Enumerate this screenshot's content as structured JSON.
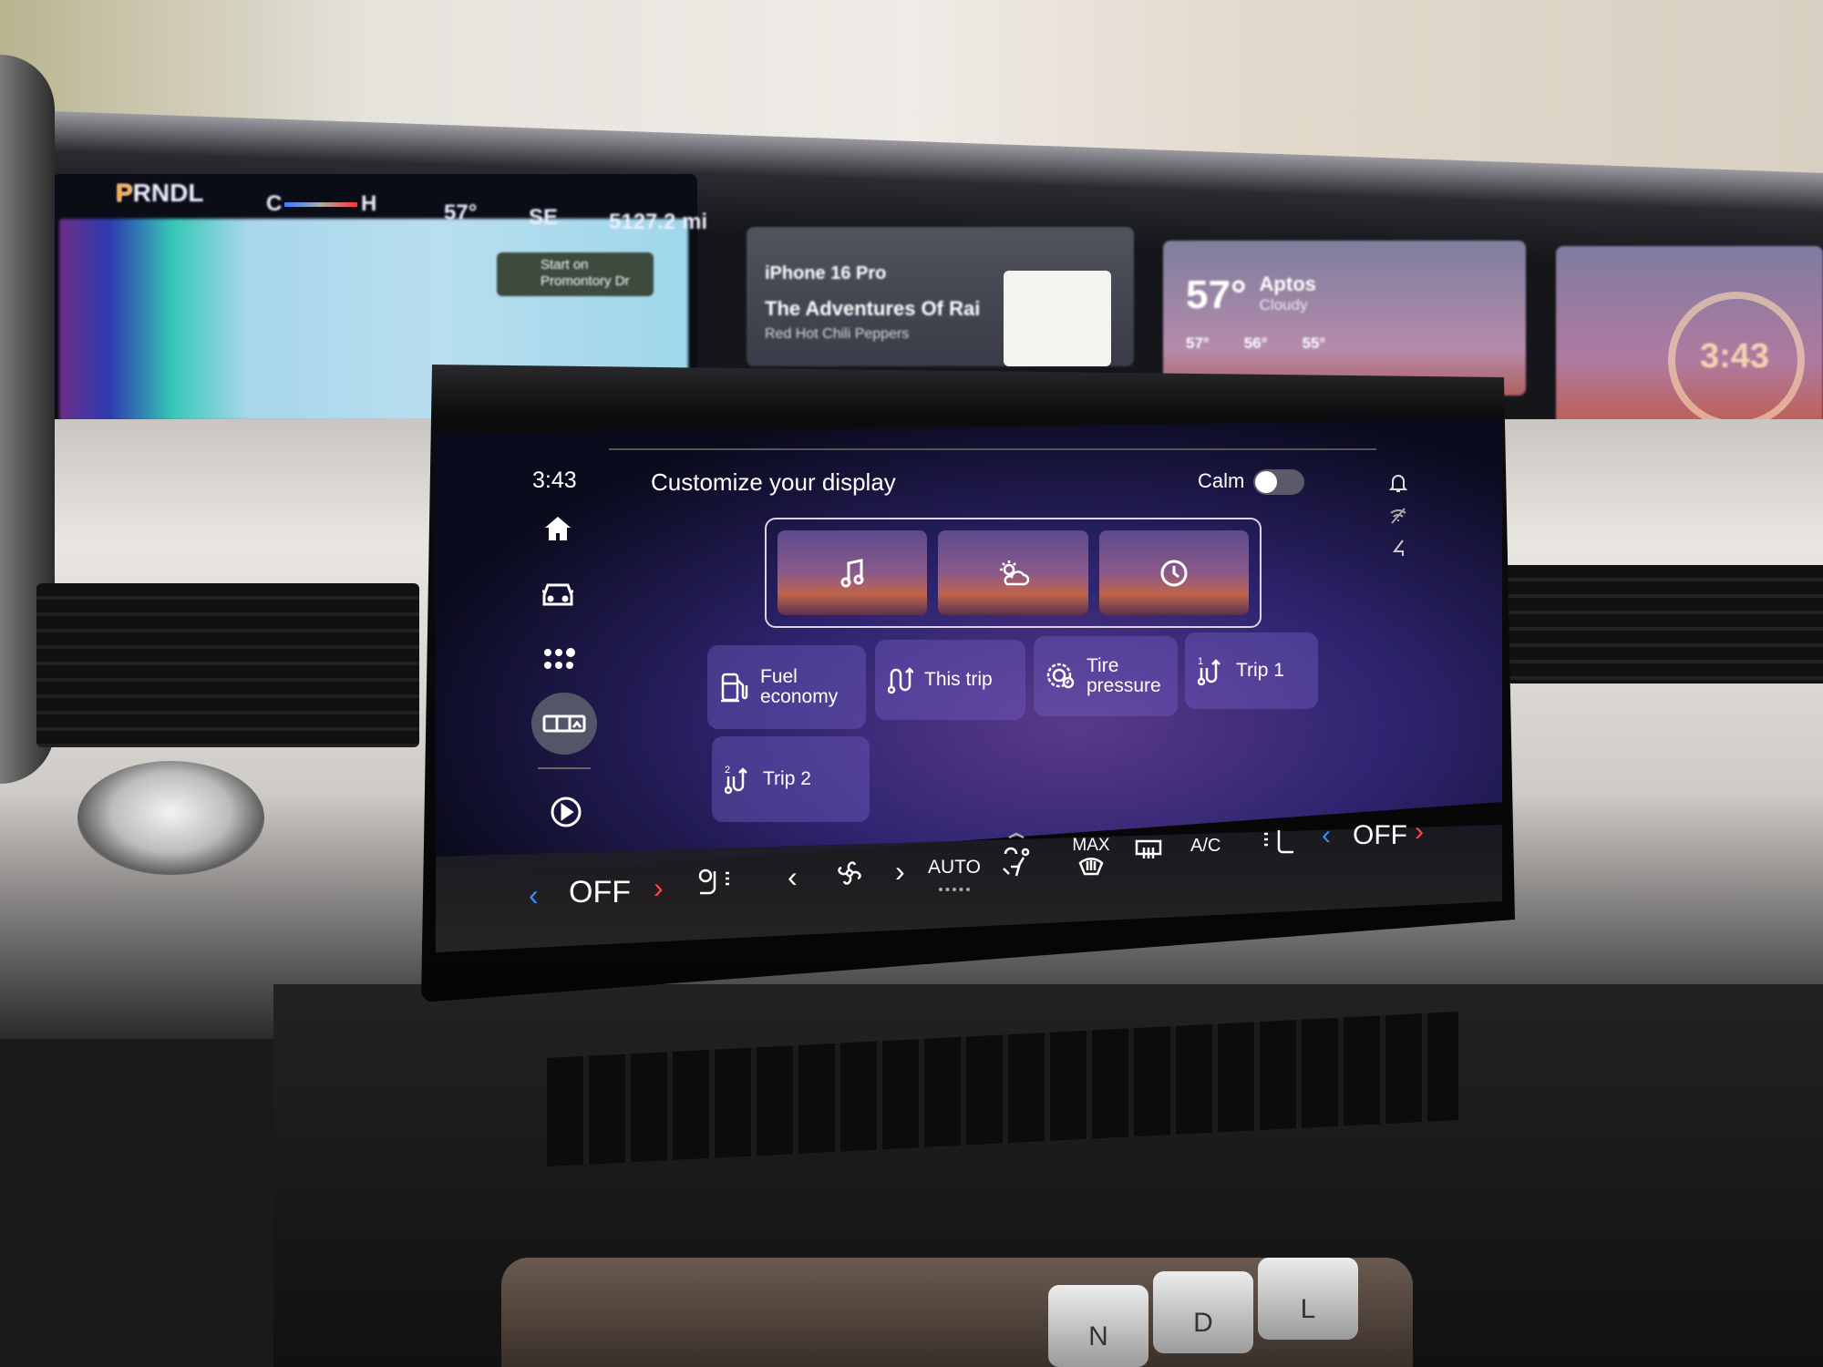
{
  "cluster": {
    "gear_indicator": "PRNDL",
    "active_gear": "P",
    "temp_gauge_low": "C",
    "temp_gauge_high": "H",
    "outside_temp": "57°",
    "heading": "SE",
    "odometer": "5127.2 mi",
    "nav_instruction": "Start on Promontory Dr",
    "media": {
      "device": "iPhone 16 Pro",
      "track": "The Adventures Of Rai",
      "artist": "Red Hot Chili Peppers"
    },
    "weather": {
      "temp": "57°",
      "city": "Aptos",
      "condition": "Cloudy",
      "forecast": [
        "57°",
        "56°",
        "55°"
      ]
    },
    "clock": "3:43"
  },
  "screen": {
    "time": "3:43",
    "title": "Customize your display",
    "calm_label": "Calm",
    "calm_on": false,
    "sidebar": [
      {
        "icon": "home-icon"
      },
      {
        "icon": "car-icon"
      },
      {
        "icon": "apps-icon"
      },
      {
        "icon": "display-layout-icon",
        "active": true
      },
      {
        "icon": "play-icon"
      }
    ],
    "status_icons": [
      "bell-icon",
      "wifi-off-icon",
      "navigation-arrow-icon"
    ],
    "widgets": [
      {
        "icon": "music-note-icon"
      },
      {
        "icon": "weather-icon"
      },
      {
        "icon": "clock-icon"
      }
    ],
    "tiles": [
      {
        "label": "Fuel economy",
        "icon": "fuel-pump-icon"
      },
      {
        "label": "This trip",
        "icon": "trip-icon"
      },
      {
        "label": "Tire pressure",
        "icon": "tire-pressure-icon"
      },
      {
        "label": "Trip 1",
        "icon": "trip-1-icon"
      },
      {
        "label": "Trip 2",
        "icon": "trip-2-icon"
      }
    ]
  },
  "climate": {
    "driver_temp": "OFF",
    "fan_mode": "AUTO",
    "max_label": "MAX",
    "ac_label": "A/C",
    "passenger_temp": "OFF",
    "accent_left": "#3a8cff",
    "accent_right": "#ff4a3a"
  },
  "shifter": [
    "N",
    "D",
    "L"
  ]
}
